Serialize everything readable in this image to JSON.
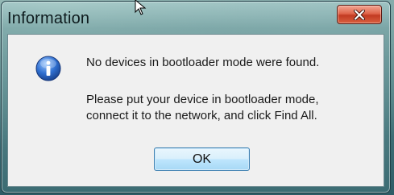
{
  "window": {
    "title": "Information",
    "close_icon": "close-icon"
  },
  "dialog": {
    "icon": "info-icon",
    "message_line1": "No devices in bootloader mode were found.",
    "message_line2": "Please put your device in bootloader mode,",
    "message_line3": "connect it to the network, and click Find All.",
    "ok_label": "OK"
  },
  "colors": {
    "close_button": "#c23a22",
    "ok_border": "#3c7fb1",
    "info_icon": "#2a67c9"
  }
}
